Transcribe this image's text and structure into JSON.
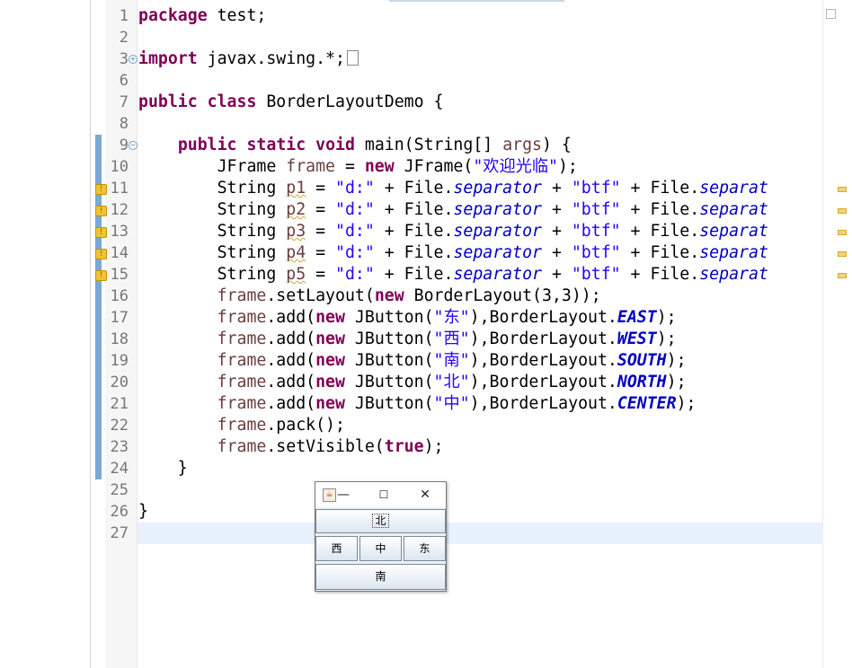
{
  "editor": {
    "lines": [
      {
        "num": "1",
        "html": "<span class='kw'>package</span> test;"
      },
      {
        "num": "2",
        "html": ""
      },
      {
        "num": "3",
        "html": "<span class='kw'>import</span> javax.swing.*;<span class='folded-box'></span>"
      },
      {
        "num": "6",
        "html": ""
      },
      {
        "num": "7",
        "html": "<span class='kw'>public</span> <span class='kw'>class</span> BorderLayoutDemo {"
      },
      {
        "num": "8",
        "html": ""
      },
      {
        "num": "9",
        "html": "    <span class='kw'>public</span> <span class='kw'>static</span> <span class='kw'>void</span> main(String[] <span class='lv'>args</span>) {"
      },
      {
        "num": "10",
        "html": "        JFrame <span class='lv'>frame</span> = <span class='kw'>new</span> JFrame(<span class='str'>\"欢迎光临\"</span>);"
      },
      {
        "num": "11",
        "html": "        String <span class='warnv'>p1</span> = <span class='str'>\"d:\"</span> + File.<span class='stat'>separator</span> + <span class='str'>\"btf\"</span> + File.<span class='stat'>separat</span>"
      },
      {
        "num": "12",
        "html": "        String <span class='warnv'>p2</span> = <span class='str'>\"d:\"</span> + File.<span class='stat'>separator</span> + <span class='str'>\"btf\"</span> + File.<span class='stat'>separat</span>"
      },
      {
        "num": "13",
        "html": "        String <span class='warnv'>p3</span> = <span class='str'>\"d:\"</span> + File.<span class='stat'>separator</span> + <span class='str'>\"btf\"</span> + File.<span class='stat'>separat</span>"
      },
      {
        "num": "14",
        "html": "        String <span class='warnv'>p4</span> = <span class='str'>\"d:\"</span> + File.<span class='stat'>separator</span> + <span class='str'>\"btf\"</span> + File.<span class='stat'>separat</span>"
      },
      {
        "num": "15",
        "html": "        String <span class='warnv'>p5</span> = <span class='str'>\"d:\"</span> + File.<span class='stat'>separator</span> + <span class='str'>\"btf\"</span> + File.<span class='stat'>separat</span>"
      },
      {
        "num": "16",
        "html": "        <span class='lv'>frame</span>.setLayout(<span class='kw'>new</span> BorderLayout(3,3));"
      },
      {
        "num": "17",
        "html": "        <span class='lv'>frame</span>.add(<span class='kw'>new</span> JButton(<span class='str'>\"东\"</span>),BorderLayout.<span class='stat-b'>EAST</span>);"
      },
      {
        "num": "18",
        "html": "        <span class='lv'>frame</span>.add(<span class='kw'>new</span> JButton(<span class='str'>\"西\"</span>),BorderLayout.<span class='stat-b'>WEST</span>);"
      },
      {
        "num": "19",
        "html": "        <span class='lv'>frame</span>.add(<span class='kw'>new</span> JButton(<span class='str'>\"南\"</span>),BorderLayout.<span class='stat-b'>SOUTH</span>);"
      },
      {
        "num": "20",
        "html": "        <span class='lv'>frame</span>.add(<span class='kw'>new</span> JButton(<span class='str'>\"北\"</span>),BorderLayout.<span class='stat-b'>NORTH</span>);"
      },
      {
        "num": "21",
        "html": "        <span class='lv'>frame</span>.add(<span class='kw'>new</span> JButton(<span class='str'>\"中\"</span>),BorderLayout.<span class='stat-b'>CENTER</span>);"
      },
      {
        "num": "22",
        "html": "        <span class='lv'>frame</span>.pack();"
      },
      {
        "num": "23",
        "html": "        <span class='lv'>frame</span>.setVisible(<span class='kw'>true</span>);"
      },
      {
        "num": "24",
        "html": "    }"
      },
      {
        "num": "25",
        "html": ""
      },
      {
        "num": "26",
        "html": "}"
      },
      {
        "num": "27",
        "html": ""
      }
    ],
    "current_line": "27"
  },
  "swing_window": {
    "title_buttons": {
      "minimize": "—",
      "maximize": "☐",
      "close": "✕"
    },
    "north": "北",
    "west": "西",
    "center": "中",
    "east": "东",
    "south": "南"
  },
  "colors": {
    "keyword": "#7f0055",
    "string": "#2a00ff",
    "static_field": "#0000c0",
    "local_var": "#6a3e3e",
    "current_line": "#e8f2fe"
  }
}
